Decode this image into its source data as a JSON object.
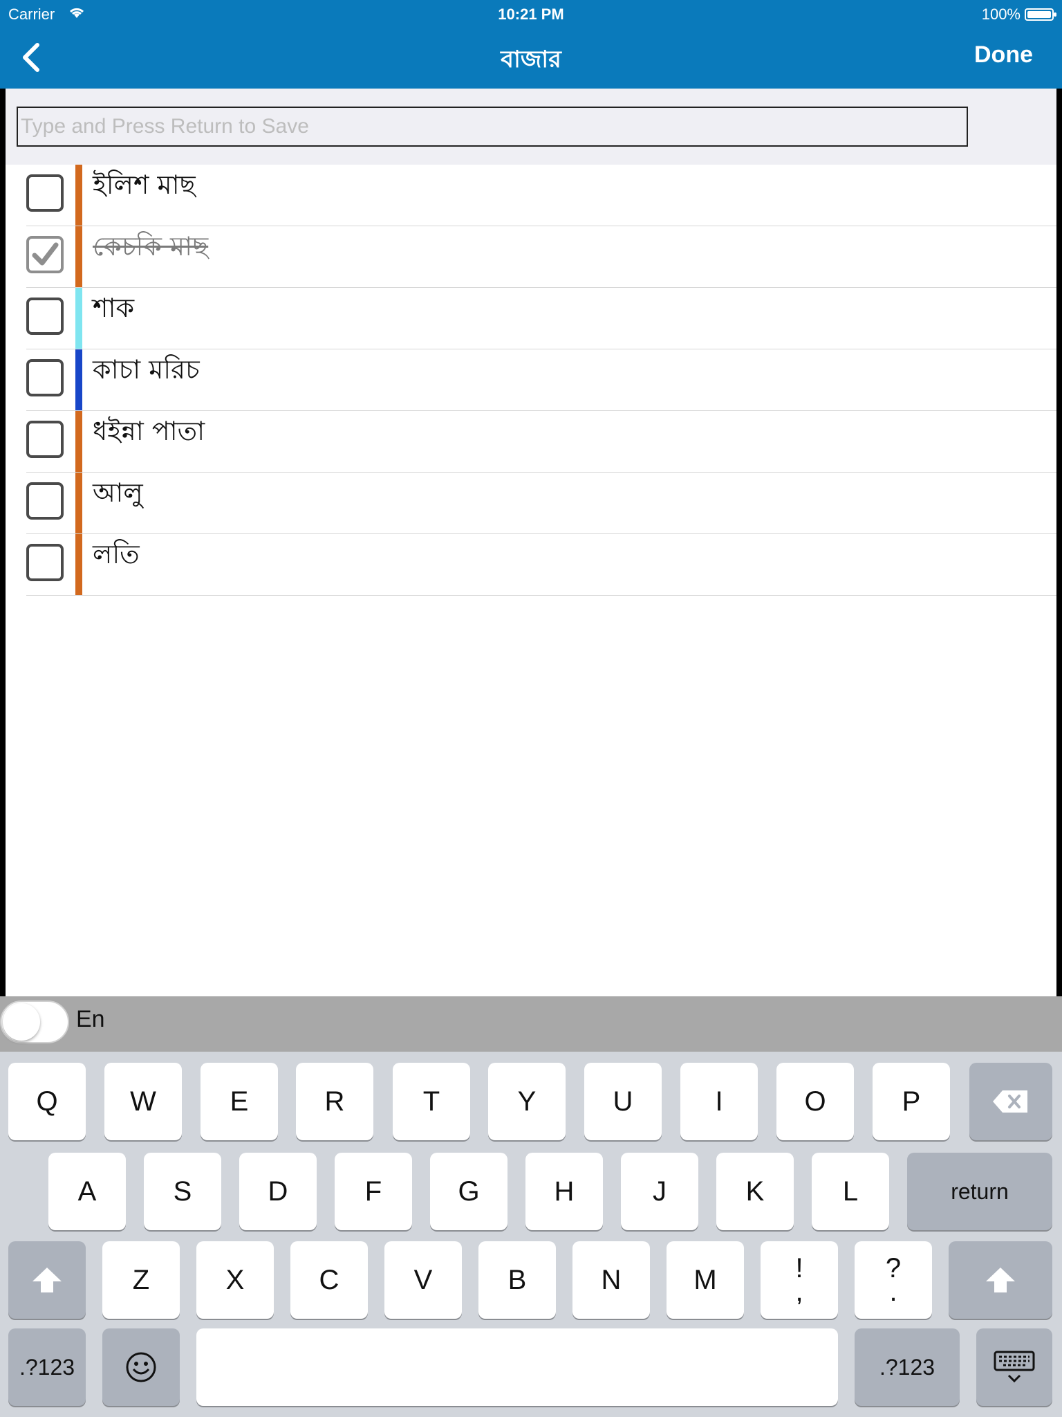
{
  "status_bar": {
    "carrier": "Carrier",
    "time": "10:21 PM",
    "battery": "100%"
  },
  "nav": {
    "title": "বাজার",
    "done_label": "Done"
  },
  "input": {
    "placeholder": "Type and Press Return to Save"
  },
  "items": [
    {
      "label": "ইলিশ মাছ",
      "checked": false,
      "color": "#d2691e"
    },
    {
      "label": "কেচকি মাছ",
      "checked": true,
      "color": "#d2691e"
    },
    {
      "label": "শাক",
      "checked": false,
      "color": "#7fe5f0"
    },
    {
      "label": "কাচা মরিচ",
      "checked": false,
      "color": "#1846c8"
    },
    {
      "label": "ধইন্না পাতা",
      "checked": false,
      "color": "#d2691e"
    },
    {
      "label": "আলু",
      "checked": false,
      "color": "#d2691e"
    },
    {
      "label": "লতি",
      "checked": false,
      "color": "#d2691e"
    }
  ],
  "keyboard": {
    "language_label": "En",
    "row1": [
      "Q",
      "W",
      "E",
      "R",
      "T",
      "Y",
      "U",
      "I",
      "O",
      "P"
    ],
    "row2": [
      "A",
      "S",
      "D",
      "F",
      "G",
      "H",
      "J",
      "K",
      "L"
    ],
    "return_label": "return",
    "row3": [
      "Z",
      "X",
      "C",
      "V",
      "B",
      "N",
      "M"
    ],
    "punct1": {
      "top": "!",
      "bottom": ","
    },
    "punct2": {
      "top": "?",
      "bottom": "."
    },
    "numbers_label": ".?123"
  }
}
